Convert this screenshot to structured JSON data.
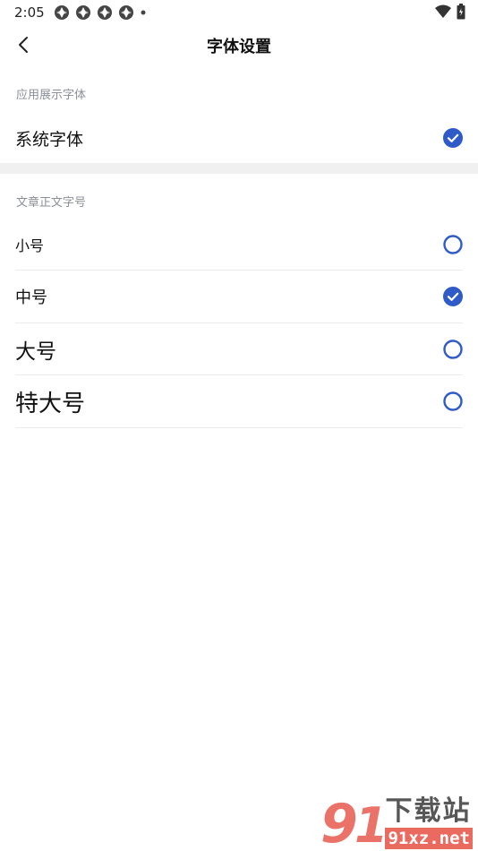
{
  "status": {
    "time": "2:05"
  },
  "header": {
    "title": "字体设置"
  },
  "sections": {
    "display_font": {
      "label": "应用展示字体",
      "options": [
        {
          "label": "系统字体",
          "selected": true
        }
      ]
    },
    "article_size": {
      "label": "文章正文字号",
      "options": [
        {
          "label": "小号",
          "selected": false
        },
        {
          "label": "中号",
          "selected": true
        },
        {
          "label": "大号",
          "selected": false
        },
        {
          "label": "特大号",
          "selected": false
        }
      ]
    }
  },
  "watermark": {
    "text_top": "下载站",
    "text_bottom": "91xz.net"
  },
  "colors": {
    "accent": "#2f5bc8",
    "divider": "#ececec",
    "band": "#f0f0f0",
    "muted": "#8a8f99"
  }
}
